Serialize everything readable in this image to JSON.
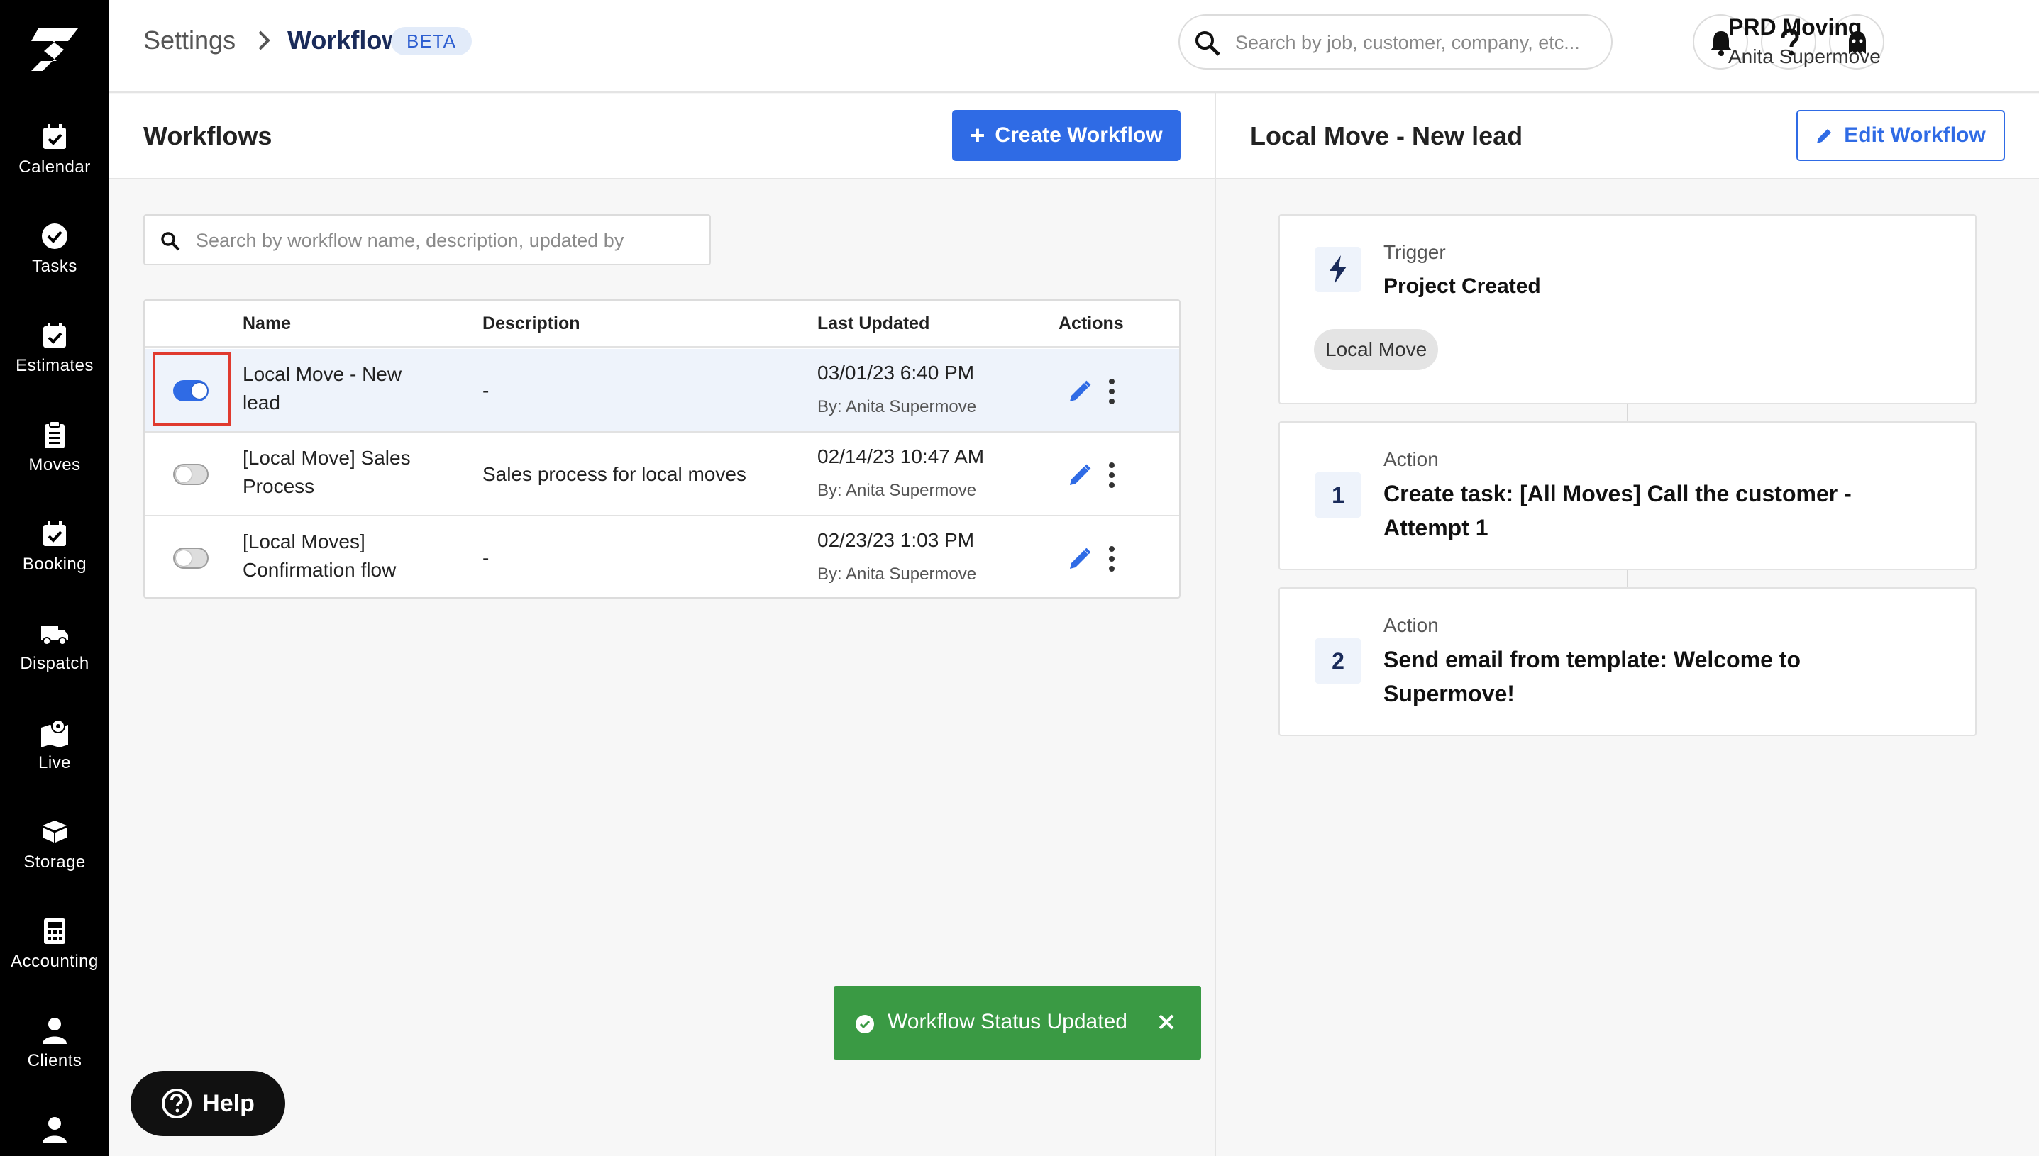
{
  "breadcrumb": {
    "parent": "Settings",
    "current": "Workflows",
    "badge": "BETA"
  },
  "global_search": {
    "placeholder": "Search by job, customer, company, etc..."
  },
  "account": {
    "company": "PRD Moving",
    "user": "Anita Supermove"
  },
  "sidebar": {
    "items": [
      {
        "label": "Calendar",
        "icon": "calendar-check-icon"
      },
      {
        "label": "Tasks",
        "icon": "check-circle-icon"
      },
      {
        "label": "Estimates",
        "icon": "calendar-check-icon"
      },
      {
        "label": "Moves",
        "icon": "clipboard-icon"
      },
      {
        "label": "Booking",
        "icon": "calendar-check-icon"
      },
      {
        "label": "Dispatch",
        "icon": "truck-icon"
      },
      {
        "label": "Live",
        "icon": "map-pin-icon"
      },
      {
        "label": "Storage",
        "icon": "boxes-icon"
      },
      {
        "label": "Accounting",
        "icon": "calculator-icon"
      },
      {
        "label": "Clients",
        "icon": "user-icon"
      }
    ]
  },
  "workflows_panel": {
    "title": "Workflows",
    "create_label": "Create Workflow",
    "search_placeholder": "Search by workflow name, description, updated by",
    "columns": {
      "name": "Name",
      "description": "Description",
      "last_updated": "Last Updated",
      "actions": "Actions"
    },
    "rows": [
      {
        "name": "Local Move - New lead",
        "description": "-",
        "date": "03/01/23 6:40 PM",
        "by": "By: Anita Supermove",
        "enabled": true
      },
      {
        "name": "[Local Move] Sales Process",
        "description": "Sales process for local moves",
        "date": "02/14/23 10:47 AM",
        "by": "By: Anita Supermove",
        "enabled": false
      },
      {
        "name": "[Local Moves] Confirmation flow",
        "description": "-",
        "date": "02/23/23 1:03 PM",
        "by": "By: Anita Supermove",
        "enabled": false
      }
    ]
  },
  "detail_panel": {
    "title": "Local Move - New lead",
    "edit_label": "Edit Workflow",
    "trigger": {
      "label": "Trigger",
      "title": "Project Created",
      "tag": "Local Move"
    },
    "actions": [
      {
        "number": "1",
        "label": "Action",
        "title": "Create task: [All Moves] Call the customer - Attempt 1"
      },
      {
        "number": "2",
        "label": "Action",
        "title": "Send email from template: Welcome to Supermove!"
      }
    ]
  },
  "toast": {
    "message": "Workflow Status Updated"
  },
  "help": {
    "label": "Help"
  },
  "colors": {
    "accent": "#2f6be5",
    "toast": "#3a9a44",
    "highlight": "#e03a2f",
    "sidebar": "#000000"
  }
}
